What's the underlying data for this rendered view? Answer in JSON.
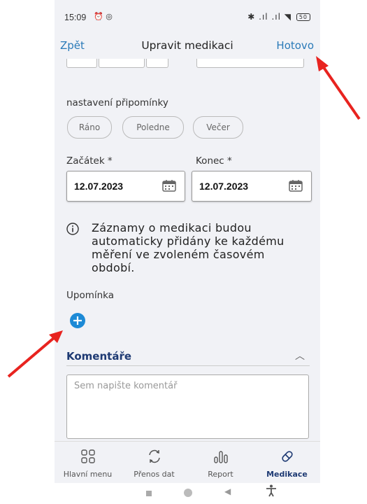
{
  "status": {
    "time": "15:09",
    "signal_text": "✱ .ıl .ıl ◥",
    "battery": "50"
  },
  "header": {
    "back_label": "Zpět",
    "title": "Upravit medikaci",
    "done_label": "Hotovo"
  },
  "reminder_settings": {
    "label": "nastavení připomínky",
    "chips": [
      "Ráno",
      "Poledne",
      "Večer"
    ]
  },
  "dates": {
    "start_label": "Začátek *",
    "start_value": "12.07.2023",
    "end_label": "Konec *",
    "end_value": "12.07.2023"
  },
  "info_text": "Záznamy o medikaci budou automaticky přidány ke každému měření ve zvoleném časovém období.",
  "reminder": {
    "label": "Upomínka"
  },
  "comments": {
    "title": "Komentáře",
    "placeholder": "Sem napište komentář"
  },
  "tabs": [
    {
      "label": "Hlavní menu",
      "icon": "grid-icon"
    },
    {
      "label": "Přenos dat",
      "icon": "sync-icon"
    },
    {
      "label": "Report",
      "icon": "report-icon"
    },
    {
      "label": "Medikace",
      "icon": "pill-icon",
      "active": true
    }
  ],
  "colors": {
    "accent": "#2a7ab8",
    "brand_dark": "#1e3a73",
    "plus": "#1d8ad6",
    "annotation_arrow": "#e8231f"
  }
}
